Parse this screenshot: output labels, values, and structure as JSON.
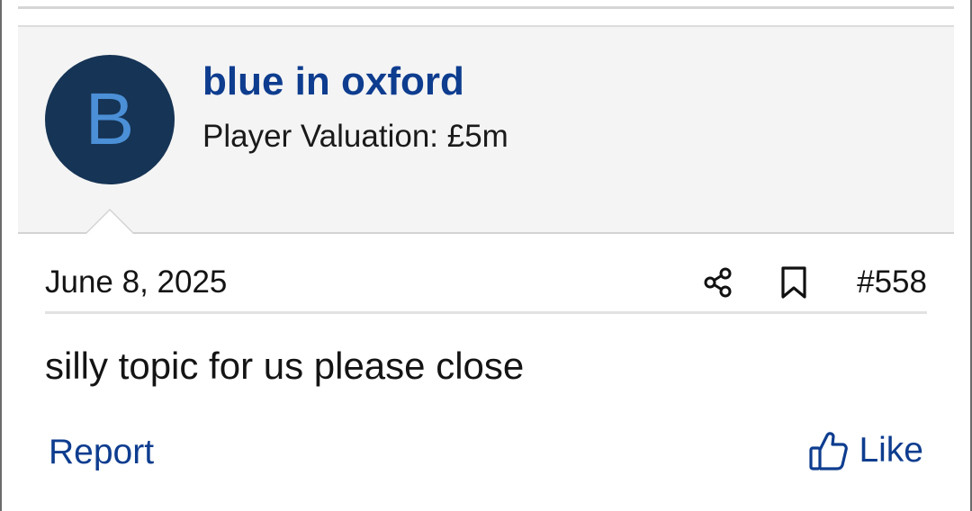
{
  "post": {
    "author": {
      "avatar_letter": "B",
      "username": "blue in oxford",
      "title": "Player Valuation: £5m",
      "avatar_bg": "#163455",
      "avatar_fg": "#4b8fd6"
    },
    "date": "June 8, 2025",
    "number": "#558",
    "body": "silly topic for us please close",
    "actions": {
      "report_label": "Report",
      "like_label": "Like"
    },
    "icons": {
      "share": "share-icon",
      "bookmark": "bookmark-icon",
      "like": "thumbs-up-icon"
    }
  },
  "colors": {
    "link": "#0e3d8f",
    "header_bg": "#f4f4f4",
    "text": "#141414"
  }
}
